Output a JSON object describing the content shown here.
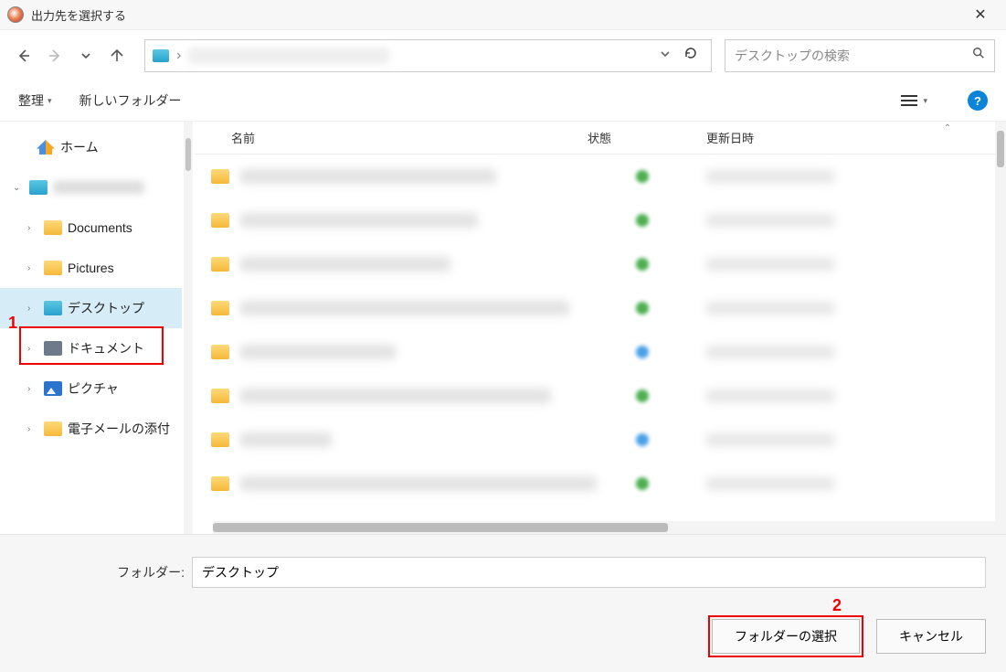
{
  "window": {
    "title": "出力先を選択する"
  },
  "nav": {
    "search_placeholder": "デスクトップの検索"
  },
  "toolbar": {
    "organize": "整理",
    "new_folder": "新しいフォルダー"
  },
  "columns": {
    "name": "名前",
    "status": "状態",
    "modified": "更新日時"
  },
  "sidebar": {
    "home": "ホーム",
    "documents": "Documents",
    "pictures": "Pictures",
    "desktop": "デスクトップ",
    "documents_jp": "ドキュメント",
    "pictures_jp": "ピクチャ",
    "email_attach": "電子メールの添付"
  },
  "files": {
    "widths": [
      280,
      260,
      230,
      360,
      170,
      340,
      100,
      390
    ],
    "status": [
      "g",
      "g",
      "g",
      "g",
      "b",
      "g",
      "b",
      "g"
    ]
  },
  "footer": {
    "folder_label": "フォルダー:",
    "folder_value": "デスクトップ",
    "select": "フォルダーの選択",
    "cancel": "キャンセル"
  },
  "annotations": {
    "one": "1",
    "two": "2"
  }
}
